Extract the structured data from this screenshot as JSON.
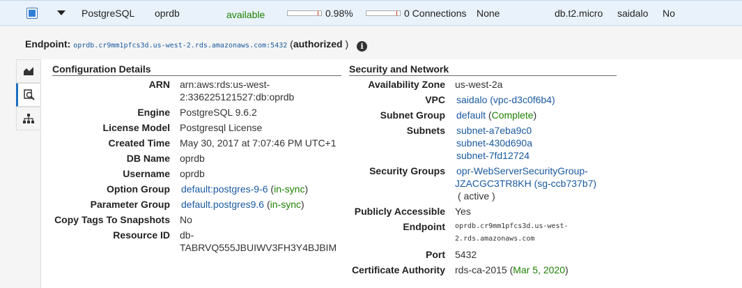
{
  "instance_row": {
    "engine": "PostgreSQL",
    "db_identifier": "oprdb",
    "status": "available",
    "cpu": "0.98%",
    "connections": "0 Connections",
    "replication": "None",
    "class": "db.t2.micro",
    "vpc": "saidalo",
    "multi_az": "No"
  },
  "endpoint_line": {
    "label": "Endpoint:",
    "value": "oprdb.cr9mm1pfcs3d.us-west-2.rds.amazonaws.com:5432",
    "paren_open": "(",
    "status": "authorized",
    "paren_close": ")"
  },
  "config": {
    "title": "Configuration Details",
    "arn_label": "ARN",
    "arn_line1": "arn:aws:rds:us-west-",
    "arn_line2": "2:336225121527:db:oprdb",
    "engine_label": "Engine",
    "engine_value": "PostgreSQL 9.6.2",
    "license_label": "License Model",
    "license_value": "Postgresql License",
    "created_label": "Created Time",
    "created_value": "May 30, 2017 at 7:07:46 PM UTC+1",
    "dbname_label": "DB Name",
    "dbname_value": "oprdb",
    "username_label": "Username",
    "username_value": "oprdb",
    "option_label": "Option Group",
    "option_value": "default:postgres-9-6",
    "option_status": "in-sync",
    "param_label": "Parameter Group",
    "param_value": "default.postgres9.6",
    "param_status": "in-sync",
    "copytags_label": "Copy Tags To Snapshots",
    "copytags_value": "No",
    "resource_label": "Resource ID",
    "resource_line1": "db-",
    "resource_line2": "TABRVQ555JBUIWV3FH3Y4BJBIM"
  },
  "security": {
    "title": "Security and Network",
    "az_label": "Availability Zone",
    "az_value": "us-west-2a",
    "vpc_label": "VPC",
    "vpc_value": "saidalo (vpc-d3c0f6b4)",
    "subnet_group_label": "Subnet Group",
    "subnet_group_value": "default",
    "subnet_group_status": "Complete",
    "subnets_label": "Subnets",
    "subnets": [
      "subnet-a7eba9c0",
      "subnet-430d690a",
      "subnet-7fd12724"
    ],
    "sg_label": "Security Groups",
    "sg_line1": "opr-WebServerSecurityGroup-",
    "sg_line2": "JZACGC3TR8KH (sg-ccb737b7)",
    "sg_status": "( active )",
    "public_label": "Publicly Accessible",
    "public_value": "Yes",
    "endpoint_label": "Endpoint",
    "endpoint_line1": "oprdb.cr9mm1pfcs3d.us-west-",
    "endpoint_line2": "2.rds.amazonaws.com",
    "port_label": "Port",
    "port_value": "5432",
    "ca_label": "Certificate Authority",
    "ca_value": "rds-ca-2015",
    "ca_date": "Mar 5, 2020"
  },
  "icons": {
    "tab1": "area-chart-icon",
    "tab2": "magnifier-details-icon",
    "tab3": "hierarchy-icon",
    "info": "info-icon"
  },
  "colors": {
    "link": "#1a5aa0",
    "status_green": "#1d8102",
    "row_highlight": "#e9f2fb"
  }
}
